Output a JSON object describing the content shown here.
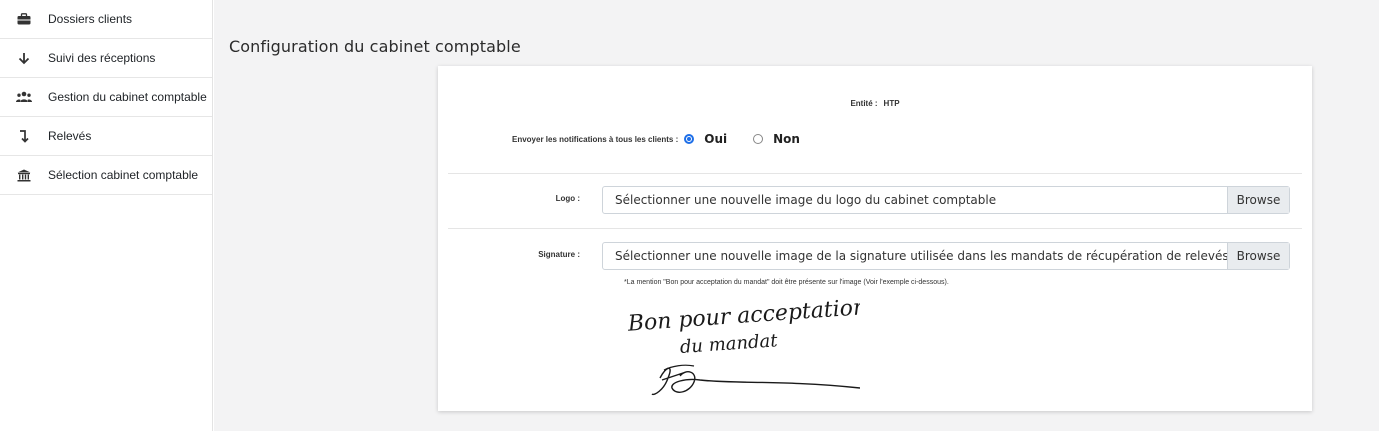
{
  "sidebar": {
    "items": [
      {
        "label": "Dossiers clients",
        "icon": "briefcase-icon"
      },
      {
        "label": "Suivi des réceptions",
        "icon": "arrow-down-icon"
      },
      {
        "label": "Gestion du cabinet comptable",
        "icon": "users-icon"
      },
      {
        "label": "Relevés",
        "icon": "level-down-icon"
      },
      {
        "label": "Sélection cabinet comptable",
        "icon": "bank-icon"
      }
    ]
  },
  "main": {
    "title": "Configuration du cabinet comptable",
    "entity": {
      "label": "Entité :",
      "value": "HTP"
    },
    "notifications": {
      "label": "Envoyer les notifications à tous les clients :",
      "options": [
        {
          "label": "Oui",
          "checked": true
        },
        {
          "label": "Non",
          "checked": false
        }
      ]
    },
    "logo": {
      "label": "Logo :",
      "placeholder": "Sélectionner une nouvelle image du logo du cabinet comptable",
      "browse": "Browse"
    },
    "signature": {
      "label": "Signature :",
      "placeholder": "Sélectionner une nouvelle image de la signature utilisée dans les mandats de récupération de relevés*",
      "browse": "Browse",
      "note": "*La mention \"Bon pour acceptation du mandat\" doit être présente sur l'image (Voir l'exemple ci-dessous).",
      "example_lines": [
        "Bon pour acceptation",
        "du mandat"
      ]
    }
  },
  "colors": {
    "accent": "#1e6fe8",
    "background": "#f3f3f4",
    "card": "#ffffff"
  }
}
